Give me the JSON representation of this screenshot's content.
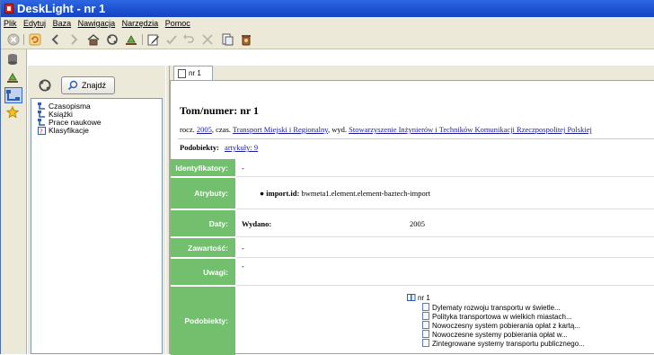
{
  "window": {
    "title": "DeskLight - nr 1"
  },
  "menu": [
    "Plik",
    "Edytuj",
    "Baza",
    "Nawigacja",
    "Narzędzia",
    "Pomoc"
  ],
  "toolbar": {
    "icons": [
      "stop-icon",
      "refresh-icon",
      "back-icon",
      "forward-icon",
      "home-icon",
      "sync-icon",
      "export-icon",
      "edit-icon",
      "apply-icon",
      "undo-icon",
      "delete-icon",
      "copy-icon",
      "trash-icon"
    ]
  },
  "tree_panel": {
    "search_label": "Znajdź",
    "items": [
      "Czasopisma",
      "Książki",
      "Prace naukowe",
      "Klasyfikacje"
    ]
  },
  "tab": {
    "label": "nr 1"
  },
  "record": {
    "title": "Tom/numer: nr 1",
    "line_prefix1": "rocz.",
    "year_link": "2005",
    "line_prefix2": ", czas.",
    "journal_link": "Transport Miejski i Regionalny",
    "line_prefix3": ", wyd.",
    "publisher_link": "Stowarzyszenie Inżynierów i Techników Komunikacji Rzeczpospolitej Polskiej",
    "children_label": "Podobiekty:",
    "children_link": "artykuły: 9"
  },
  "fields": {
    "identifiers": {
      "label": "Identyfikatory:",
      "value": "-"
    },
    "attributes": {
      "label": "Atrybuty:",
      "key": "import.id:",
      "value": "bwmeta1.element.element-baztech-import"
    },
    "dates": {
      "label": "Daty:",
      "key": "Wydano:",
      "value": "2005"
    },
    "content": {
      "label": "Zawartość:",
      "value": "-"
    },
    "notes": {
      "label": "Uwagi:",
      "value": "-"
    },
    "children": {
      "label": "Podobiekty:",
      "root": "nr 1",
      "items": [
        "Dylematy rozwoju transportu w świetle...",
        "Polityka transportowa w wielkich miastach...",
        "Nowoczesny system pobierania opłat z kartą...",
        "Nowoczesne systemy pobierania opłat w...",
        "Zintegrowane systemy transportu publicznego..."
      ]
    }
  },
  "colors": {
    "field_label_bg": "#72bf6e",
    "titlebar": "#2f67e3",
    "link": "#1a1a9e"
  }
}
